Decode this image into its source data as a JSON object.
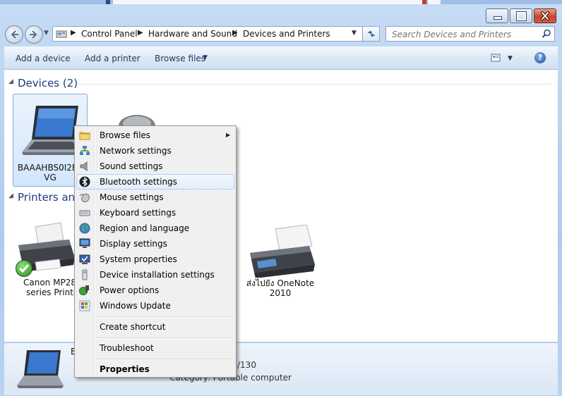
{
  "address": {
    "crumbs": [
      "Control Panel",
      "Hardware and Sound",
      "Devices and Printers"
    ]
  },
  "search": {
    "placeholder": "Search Devices and Printers"
  },
  "toolbar": {
    "add_device": "Add a device",
    "add_printer": "Add a printer",
    "browse_files": "Browse files"
  },
  "groups": {
    "devices": "Devices (2)",
    "printers": "Printers and"
  },
  "devices": {
    "laptop_name_line1": "BAAAHBS0I2EE",
    "laptop_name_line2": "VG"
  },
  "printers": {
    "canon_line1": "Canon MP280",
    "canon_line2": "series Printer",
    "onenote_line1": "ส่งไปยัง OneNote",
    "onenote_line2": "2010"
  },
  "details": {
    "name_initial": "B",
    "model_fragment": "/130",
    "category_fragment": "Category: Portable computer"
  },
  "context_menu": {
    "items": [
      {
        "label": "Browse files",
        "icon": "folder-icon"
      },
      {
        "label": "Network settings",
        "icon": "network-icon"
      },
      {
        "label": "Sound settings",
        "icon": "speaker-icon"
      },
      {
        "label": "Bluetooth settings",
        "icon": "bluetooth-icon"
      },
      {
        "label": "Mouse settings",
        "icon": "mouse-icon"
      },
      {
        "label": "Keyboard settings",
        "icon": "keyboard-icon"
      },
      {
        "label": "Region and language",
        "icon": "globe-icon"
      },
      {
        "label": "Display settings",
        "icon": "monitor-icon"
      },
      {
        "label": "System properties",
        "icon": "system-icon"
      },
      {
        "label": "Device installation settings",
        "icon": "device-install-icon"
      },
      {
        "label": "Power options",
        "icon": "power-icon"
      },
      {
        "label": "Windows Update",
        "icon": "windows-update-icon"
      },
      {
        "label": "Create shortcut"
      },
      {
        "label": "Troubleshoot"
      },
      {
        "label": "Properties"
      }
    ]
  },
  "colors": {
    "accent": "#1e3c78",
    "highlight_border": "#aecff7"
  }
}
